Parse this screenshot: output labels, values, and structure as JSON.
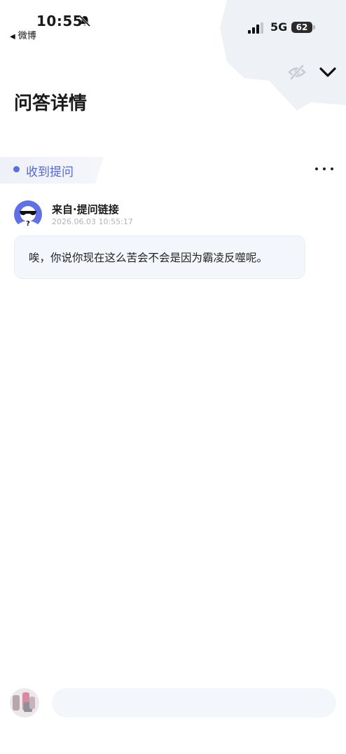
{
  "status_bar": {
    "time": "10:55",
    "back_app": "微博",
    "network": "5G",
    "battery": "62"
  },
  "header": {
    "title": "问答详情"
  },
  "tag": {
    "label": "收到提问"
  },
  "question": {
    "source": "来自·提问链接",
    "timestamp": "2026.06.03 10:55:17",
    "text": "唉，你说你现在这么苦会不会是因为霸凌反噬呢。"
  },
  "reply": {
    "placeholder": ""
  },
  "colors": {
    "accent": "#5b6fe0",
    "bubble_bg": "#f3f7fc",
    "timestamp": "#b0b4bb"
  },
  "icons": [
    "bell-muted-icon",
    "signal-icon",
    "battery-icon",
    "eye-hidden-icon",
    "chevron-down-icon",
    "more-icon"
  ]
}
